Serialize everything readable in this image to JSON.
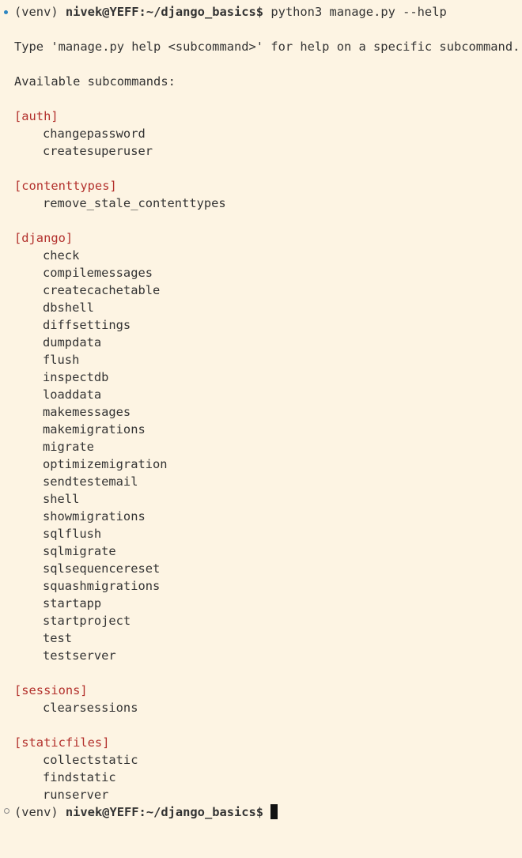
{
  "prompt": {
    "venv": "(venv) ",
    "user_host": "nivek@YEFF",
    "path": ":~/django_basics$ "
  },
  "command": "python3 manage.py --help",
  "help_text": "Type 'manage.py help <subcommand>' for help on a specific subcommand.",
  "available_label": "Available subcommands:",
  "groups": [
    {
      "name": "[auth]",
      "commands": [
        "changepassword",
        "createsuperuser"
      ]
    },
    {
      "name": "[contenttypes]",
      "commands": [
        "remove_stale_contenttypes"
      ]
    },
    {
      "name": "[django]",
      "commands": [
        "check",
        "compilemessages",
        "createcachetable",
        "dbshell",
        "diffsettings",
        "dumpdata",
        "flush",
        "inspectdb",
        "loaddata",
        "makemessages",
        "makemigrations",
        "migrate",
        "optimizemigration",
        "sendtestemail",
        "shell",
        "showmigrations",
        "sqlflush",
        "sqlmigrate",
        "sqlsequencereset",
        "squashmigrations",
        "startapp",
        "startproject",
        "test",
        "testserver"
      ]
    },
    {
      "name": "[sessions]",
      "commands": [
        "clearsessions"
      ]
    },
    {
      "name": "[staticfiles]",
      "commands": [
        "collectstatic",
        "findstatic",
        "runserver"
      ]
    }
  ],
  "colors": {
    "background": "#fdf4e3",
    "text": "#333333",
    "category": "#b3312d",
    "success_marker": "#2e86c1"
  }
}
